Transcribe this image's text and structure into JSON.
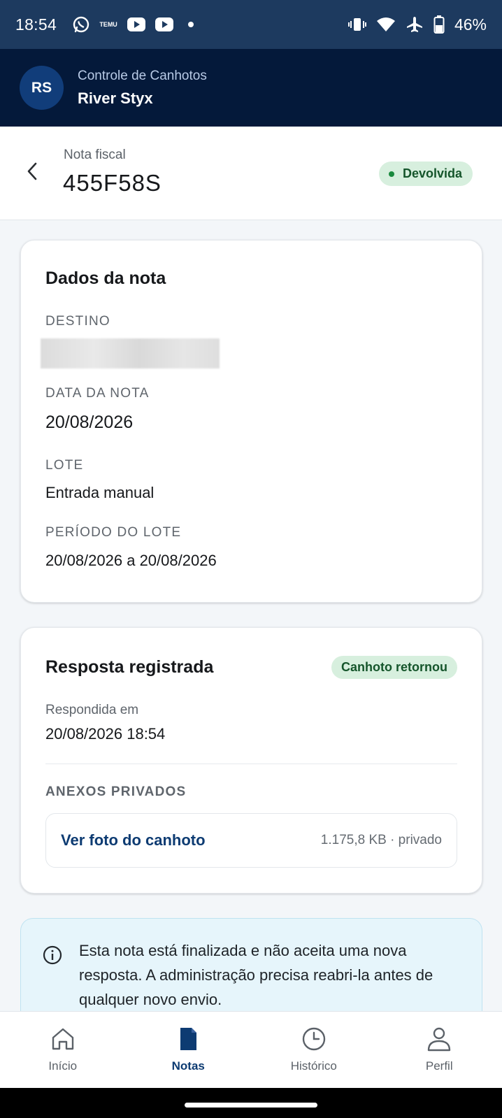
{
  "status_bar": {
    "time": "18:54",
    "battery": "46%",
    "left_icons": [
      "whatsapp-icon",
      "temu-icon",
      "youtube-icon",
      "youtube-icon",
      "dot-icon"
    ],
    "right_icons": [
      "vibrate-icon",
      "wifi-icon",
      "airplane-icon",
      "battery-icon"
    ],
    "temu_text": "TEMU"
  },
  "app_header": {
    "avatar_initials": "RS",
    "subtitle": "Controle de Canhotos",
    "title": "River Styx"
  },
  "nota_header": {
    "label": "Nota fiscal",
    "number": "455F58S",
    "status": "Devolvida"
  },
  "dados_card": {
    "title": "Dados da nota",
    "destino_label": "DESTINO",
    "data_label": "DATA DA NOTA",
    "data_value": "20/08/2026",
    "lote_label": "LOTE",
    "lote_value": "Entrada manual",
    "periodo_label": "PERÍODO DO LOTE",
    "periodo_value": "20/08/2026 a 20/08/2026"
  },
  "resposta_card": {
    "title": "Resposta registrada",
    "badge": "Canhoto retornou",
    "respondida_label": "Respondida em",
    "respondida_value": "20/08/2026 18:54",
    "anexos_label": "ANEXOS PRIVADOS",
    "attachment_link": "Ver foto do canhoto",
    "attachment_meta": "1.175,8 KB · privado"
  },
  "info_box": {
    "text": "Esta nota está finalizada e não aceita uma nova resposta. A administração precisa reabri-la antes de qualquer novo envio."
  },
  "bottom_nav": {
    "items": [
      {
        "label": "Início",
        "icon": "home-icon"
      },
      {
        "label": "Notas",
        "icon": "document-icon"
      },
      {
        "label": "Histórico",
        "icon": "clock-icon"
      },
      {
        "label": "Perfil",
        "icon": "person-icon"
      }
    ],
    "active": "Notas"
  },
  "colors": {
    "status_bar_bg": "#1d3a5f",
    "app_header_bg": "#04193a",
    "accent": "#0d3b72",
    "badge_bg": "#d7efde",
    "badge_text": "#15552b",
    "info_bg": "#e6f5fb"
  }
}
